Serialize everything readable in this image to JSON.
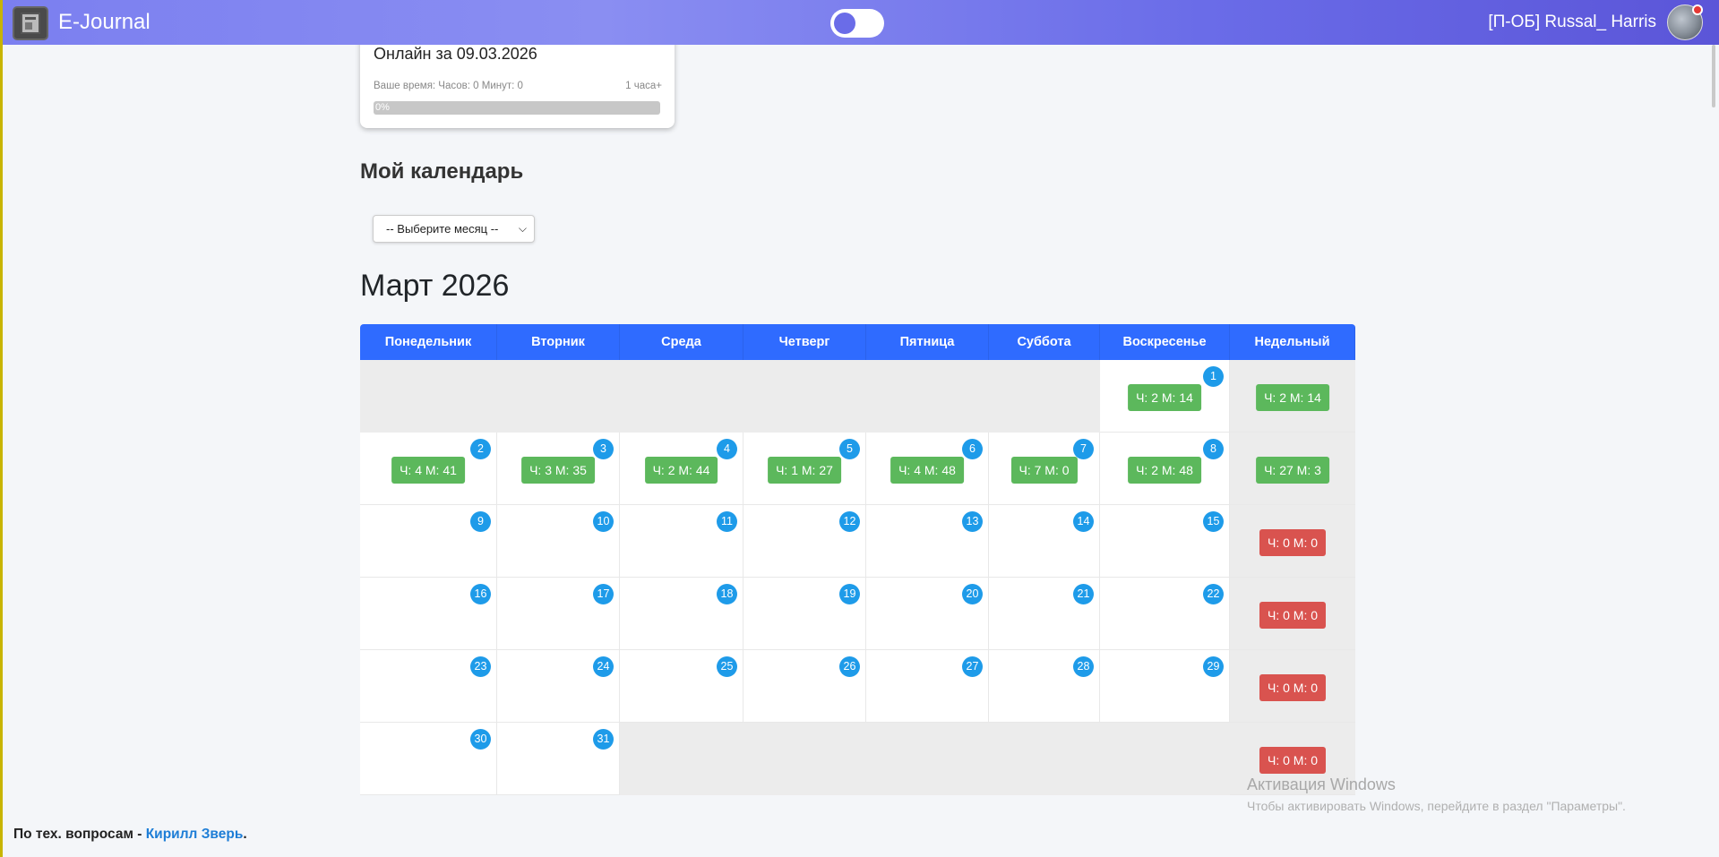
{
  "app": {
    "brand": "E-Journal",
    "theme_toggle_on": false
  },
  "user": {
    "name": "[П-ОБ] Russal_ Harris"
  },
  "online": {
    "title": "Онлайн за 09.03.2026",
    "time_label": "Ваше время: Часов: 0 Минут: 0",
    "goal_label": "1 часа+",
    "progress_fraction": 0,
    "progress_text": "0%"
  },
  "calendar": {
    "heading": "Мой календарь",
    "month_select_value": "-- Выберите месяц --",
    "month_title": "Март 2026",
    "columns": [
      "Понедельник",
      "Вторник",
      "Среда",
      "Четверг",
      "Пятница",
      "Суббота",
      "Воскресенье",
      "Недельный"
    ],
    "weeks": [
      {
        "days": [
          null,
          null,
          null,
          null,
          null,
          null,
          {
            "day": "1",
            "time": "Ч: 2 М: 14"
          }
        ],
        "weekly": {
          "time": "Ч: 2 М: 14",
          "status": "green"
        }
      },
      {
        "days": [
          {
            "day": "2",
            "time": "Ч: 4 М: 41"
          },
          {
            "day": "3",
            "time": "Ч: 3 М: 35"
          },
          {
            "day": "4",
            "time": "Ч: 2 М: 44"
          },
          {
            "day": "5",
            "time": "Ч: 1 М: 27"
          },
          {
            "day": "6",
            "time": "Ч: 4 М: 48"
          },
          {
            "day": "7",
            "time": "Ч: 7 М: 0"
          },
          {
            "day": "8",
            "time": "Ч: 2 М: 48"
          }
        ],
        "weekly": {
          "time": "Ч: 27 М: 3",
          "status": "green"
        }
      },
      {
        "days": [
          {
            "day": "9"
          },
          {
            "day": "10"
          },
          {
            "day": "11"
          },
          {
            "day": "12"
          },
          {
            "day": "13"
          },
          {
            "day": "14"
          },
          {
            "day": "15"
          }
        ],
        "weekly": {
          "time": "Ч: 0 М: 0",
          "status": "red"
        }
      },
      {
        "days": [
          {
            "day": "16"
          },
          {
            "day": "17"
          },
          {
            "day": "18"
          },
          {
            "day": "19"
          },
          {
            "day": "20"
          },
          {
            "day": "21"
          },
          {
            "day": "22"
          }
        ],
        "weekly": {
          "time": "Ч: 0 М: 0",
          "status": "red"
        }
      },
      {
        "days": [
          {
            "day": "23"
          },
          {
            "day": "24"
          },
          {
            "day": "25"
          },
          {
            "day": "26"
          },
          {
            "day": "27"
          },
          {
            "day": "28"
          },
          {
            "day": "29"
          }
        ],
        "weekly": {
          "time": "Ч: 0 М: 0",
          "status": "red"
        }
      },
      {
        "days": [
          {
            "day": "30"
          },
          {
            "day": "31"
          },
          null,
          null,
          null,
          null,
          null
        ],
        "weekly": {
          "time": "Ч: 0 М: 0",
          "status": "red"
        }
      }
    ]
  },
  "watermark": {
    "line1": "Активация Windows",
    "line2": "Чтобы активировать Windows, перейдите в раздел \"Параметры\"."
  },
  "footer": {
    "text": "По тех. вопросам - ",
    "link_text": "Кирилл Зверь",
    "suffix": "."
  },
  "colors": {
    "navbar_start": "#7b7ff0",
    "navbar_end": "#5b55d8",
    "table_header": "#2f6bff",
    "day_circle": "#1e9be9",
    "badge_green": "#5cb85c",
    "badge_red": "#d9534f"
  }
}
